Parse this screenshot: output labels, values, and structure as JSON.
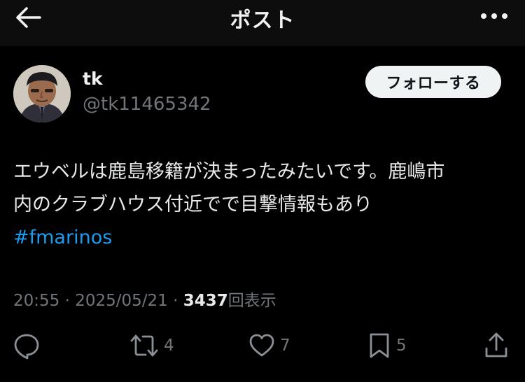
{
  "header": {
    "title": "ポスト"
  },
  "user": {
    "name": "tk",
    "handle": "@tk11465342",
    "follow_label": "フォローする"
  },
  "post": {
    "lines": [
      "エウベルは鹿島移籍が決まったみたいです。鹿嶋市",
      "内のクラブハウス付近でで目撃情報もあり"
    ],
    "hashtag": "#fmarinos",
    "time": "20:55",
    "separator": "·",
    "date": "2025/05/21",
    "views_count": "3437",
    "views_label": "回表示"
  },
  "actions": {
    "reply_count": "",
    "retweet_count": "4",
    "like_count": "7",
    "bookmark_count": "5"
  },
  "colors": {
    "background": "#000000",
    "text": "#e7e9ea",
    "muted": "#71767b",
    "link": "#1d9bf0",
    "follow_button_bg": "#eff3f4"
  },
  "icons": {
    "back": "arrow-left-icon",
    "more": "more-horizontal-icon",
    "reply": "reply-icon",
    "retweet": "retweet-icon",
    "like": "heart-icon",
    "bookmark": "bookmark-icon",
    "share": "share-icon"
  }
}
